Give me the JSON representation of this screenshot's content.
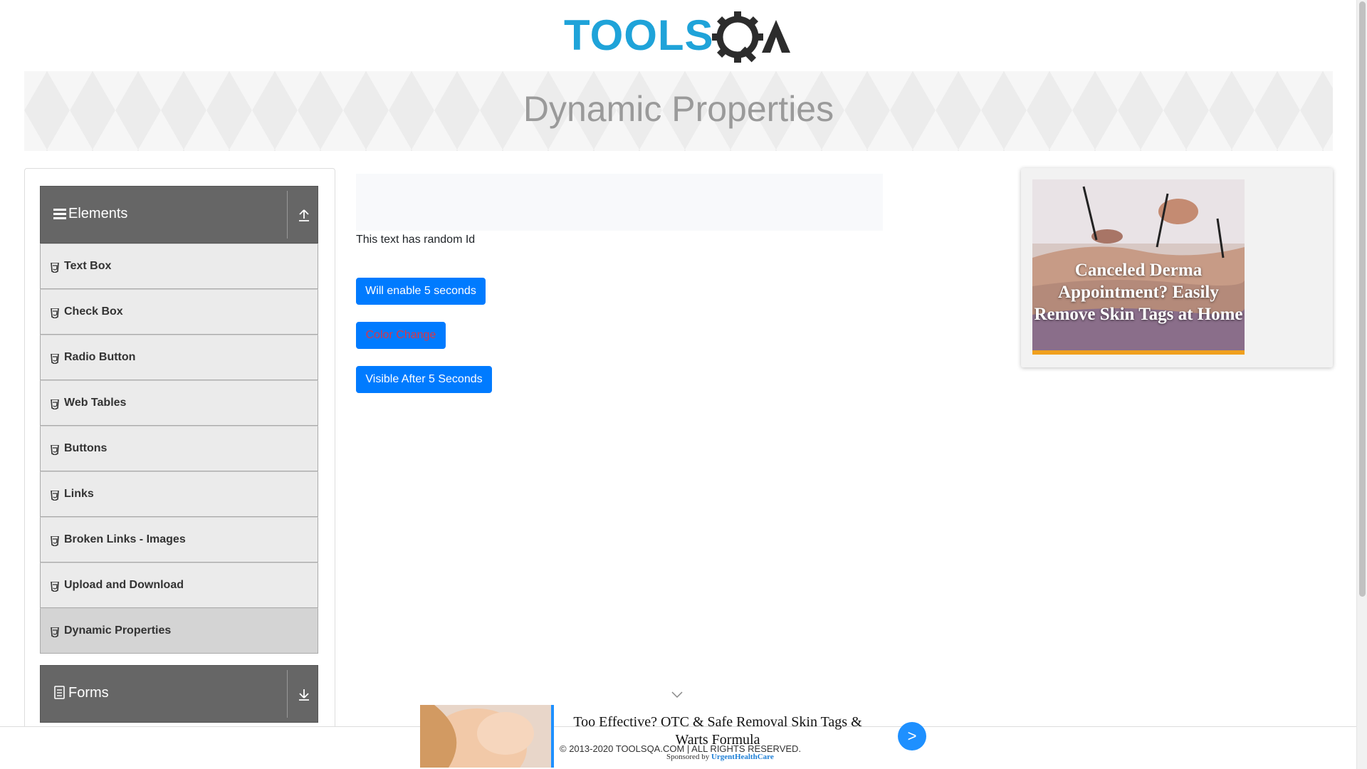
{
  "header": {
    "logo_text": "TOOLSQA",
    "page_title": "Dynamic Properties"
  },
  "sidebar": {
    "groups": [
      {
        "label": "Elements",
        "icon": "bars-icon",
        "toggle": "collapse-up-icon"
      },
      {
        "label": "Forms",
        "icon": "document-icon",
        "toggle": "expand-down-icon"
      }
    ],
    "items": [
      {
        "label": "Text Box"
      },
      {
        "label": "Check Box"
      },
      {
        "label": "Radio Button"
      },
      {
        "label": "Web Tables"
      },
      {
        "label": "Buttons"
      },
      {
        "label": "Links"
      },
      {
        "label": "Broken Links - Images"
      },
      {
        "label": "Upload and Download"
      },
      {
        "label": "Dynamic Properties"
      }
    ]
  },
  "main": {
    "random_text": "This text has random Id",
    "enable_button": "Will enable 5 seconds",
    "color_button": "Color Change",
    "visible_button": "Visible After 5 Seconds"
  },
  "right_ad": {
    "caption": "Canceled Derma Appointment? Easily Remove Skin Tags at Home"
  },
  "bottom_ad": {
    "headline": "Too Effective? OTC & Safe Removal Skin Tags & Warts Formula",
    "sponsored_prefix": "Sponsored by",
    "sponsor": "UrgentHealthCare",
    "next_label": ">"
  },
  "footer": {
    "copyright": "© 2013-2020 TOOLSQA.COM | ALL RIGHTS RESERVED."
  },
  "colors": {
    "primary": "#007bff",
    "color_change_text": "#dc3545",
    "group_header": "#666666",
    "logo_blue": "#1fa3d9",
    "logo_dark": "#2c2c2c"
  }
}
